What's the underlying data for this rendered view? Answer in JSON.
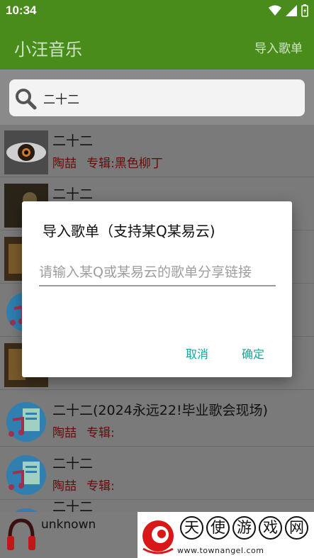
{
  "status": {
    "time": "10:34"
  },
  "appbar": {
    "title": "小汪音乐",
    "action": "导入歌单"
  },
  "search": {
    "query": "二十二"
  },
  "songs": [
    {
      "name": "二十二",
      "artist": "陶喆",
      "album": "专辑:黑色柳丁"
    },
    {
      "name": "二十二",
      "artist": "",
      "album": ""
    },
    {
      "name": "",
      "artist": "",
      "album": ""
    },
    {
      "name": "",
      "artist": "",
      "album": ""
    },
    {
      "name": "",
      "artist": "",
      "album": ""
    },
    {
      "name": "二十二(2024永远22!毕业歌会现场)",
      "artist": "陶喆",
      "album": "专辑:"
    },
    {
      "name": "二十二",
      "artist": "陶喆",
      "album": "专辑:"
    },
    {
      "name": "二十二",
      "artist": "",
      "album": ""
    }
  ],
  "player": {
    "title": "unknown"
  },
  "watermark": {
    "chars": [
      "天",
      "使",
      "游",
      "戏",
      "网"
    ],
    "url": "www.townangel.com"
  },
  "dialog": {
    "title": "导入歌单（支持某Q某易云)",
    "placeholder": "请输入某Q或某易云的歌单分享链接",
    "cancel": "取消",
    "confirm": "确定"
  },
  "colors": {
    "appbar": "#4a8c1c",
    "accent": "#16a596",
    "artist": "#6b0a0a"
  }
}
